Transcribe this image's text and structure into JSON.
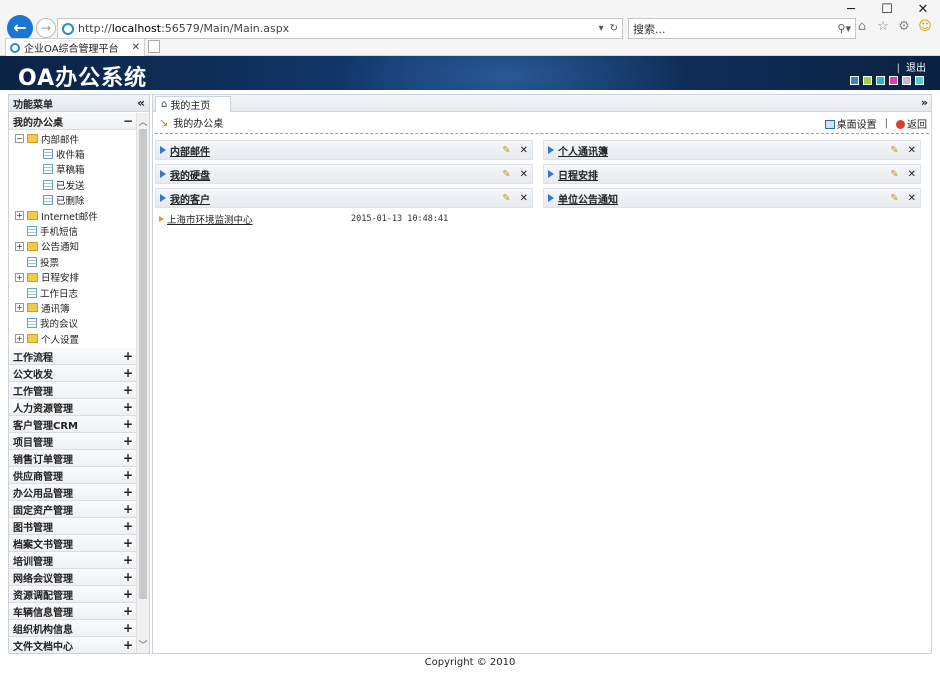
{
  "browser": {
    "url_prefix": "http://",
    "url_host": "localhost",
    "url_rest": ":56579/Main/Main.aspx",
    "search_placeholder": "搜索...",
    "tab_title": "企业OA综合管理平台",
    "window_controls": [
      "─",
      "☐",
      "✕"
    ]
  },
  "app": {
    "logo": "OA办公系统",
    "logout": "退出",
    "skin_colors": [
      "#3b7fd6",
      "#9bd240",
      "#26b0e0",
      "#e03cb0",
      "#c7b7d9",
      "#54c7d0"
    ]
  },
  "sidebar": {
    "title": "功能菜单",
    "collapse_icon": "«",
    "open_group": {
      "label": "我的办公桌",
      "toggle": "−",
      "tree": [
        {
          "label": "内部邮件",
          "type": "folder",
          "level": 0,
          "exp": "−"
        },
        {
          "label": "收件箱",
          "type": "page",
          "level": 1
        },
        {
          "label": "草稿箱",
          "type": "page",
          "level": 1
        },
        {
          "label": "已发送",
          "type": "page",
          "level": 1
        },
        {
          "label": "已删除",
          "type": "page",
          "level": 1
        },
        {
          "label": "Internet邮件",
          "type": "folder",
          "level": 0,
          "exp": "+"
        },
        {
          "label": "手机短信",
          "type": "page",
          "level": 0
        },
        {
          "label": "公告通知",
          "type": "folder",
          "level": 0,
          "exp": "+"
        },
        {
          "label": "投票",
          "type": "page",
          "level": 0
        },
        {
          "label": "日程安排",
          "type": "folder",
          "level": 0,
          "exp": "+"
        },
        {
          "label": "工作日志",
          "type": "page",
          "level": 0
        },
        {
          "label": "通讯簿",
          "type": "folder",
          "level": 0,
          "exp": "+"
        },
        {
          "label": "我的会议",
          "type": "page",
          "level": 0
        },
        {
          "label": "个人设置",
          "type": "folder",
          "level": 0,
          "exp": "+"
        }
      ]
    },
    "groups": [
      "工作流程",
      "公文收发",
      "工作管理",
      "人力资源管理",
      "客户管理CRM",
      "项目管理",
      "销售订单管理",
      "供应商管理",
      "办公用品管理",
      "固定资产管理",
      "图书管理",
      "档案文书管理",
      "培训管理",
      "网络会议管理",
      "资源调配管理",
      "车辆信息管理",
      "组织机构信息",
      "文件文档中心"
    ],
    "group_toggle": "+"
  },
  "main": {
    "tab_label": "我的主页",
    "desk_title": "我的办公桌",
    "desk_settings": "桌面设置",
    "back": "返回",
    "separator": "|",
    "left_portlets": [
      {
        "title": "内部邮件",
        "rows": []
      },
      {
        "title": "我的硬盘",
        "rows": []
      },
      {
        "title": "我的客户",
        "rows": [
          {
            "name": "上海市环境监测中心",
            "time": "2015-01-13 10:48:41"
          }
        ]
      }
    ],
    "right_portlets": [
      {
        "title": "个人通讯簿",
        "rows": []
      },
      {
        "title": "日程安排",
        "rows": []
      },
      {
        "title": "单位公告通知",
        "rows": []
      }
    ]
  },
  "footer": "Copyright © 2010"
}
